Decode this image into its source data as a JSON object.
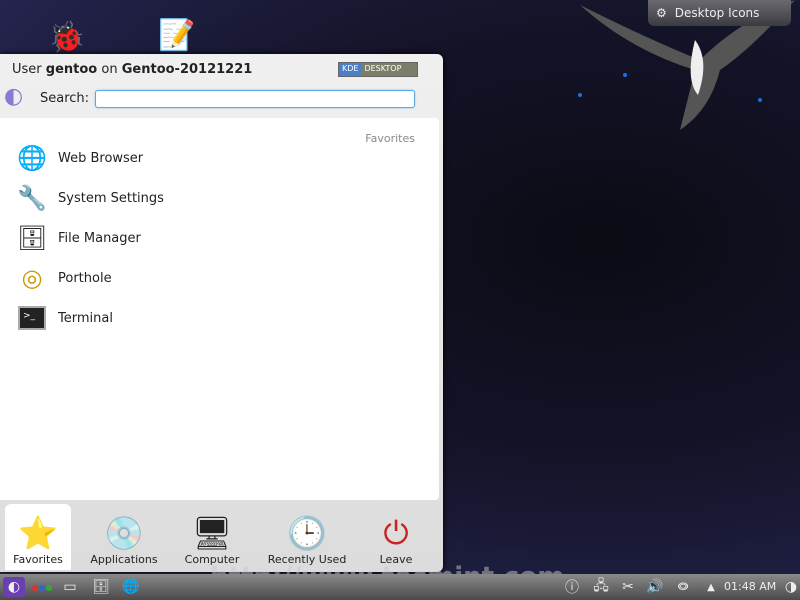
{
  "desktop": {
    "button_label": "Desktop Icons",
    "watermark": "http://www.tecmint.com"
  },
  "menu": {
    "user_prefix": "User",
    "user": "gentoo",
    "host_prefix": "on",
    "host": "Gentoo-20121221",
    "kde_badge": [
      "KDE",
      "DESKTOP"
    ],
    "search_label": "Search:",
    "search_value": "",
    "section_title": "Favorites",
    "items": [
      {
        "label": "Web Browser",
        "icon": "globe-icon"
      },
      {
        "label": "System Settings",
        "icon": "tools-icon"
      },
      {
        "label": "File Manager",
        "icon": "file-cabinet-icon"
      },
      {
        "label": "Porthole",
        "icon": "porthole-icon"
      },
      {
        "label": "Terminal",
        "icon": "terminal-icon"
      }
    ],
    "tabs": [
      {
        "label": "Favorites",
        "active": true
      },
      {
        "label": "Applications"
      },
      {
        "label": "Computer"
      },
      {
        "label": "Recently Used"
      },
      {
        "label": "Leave"
      }
    ]
  },
  "taskbar": {
    "clock": "01:48 AM"
  }
}
